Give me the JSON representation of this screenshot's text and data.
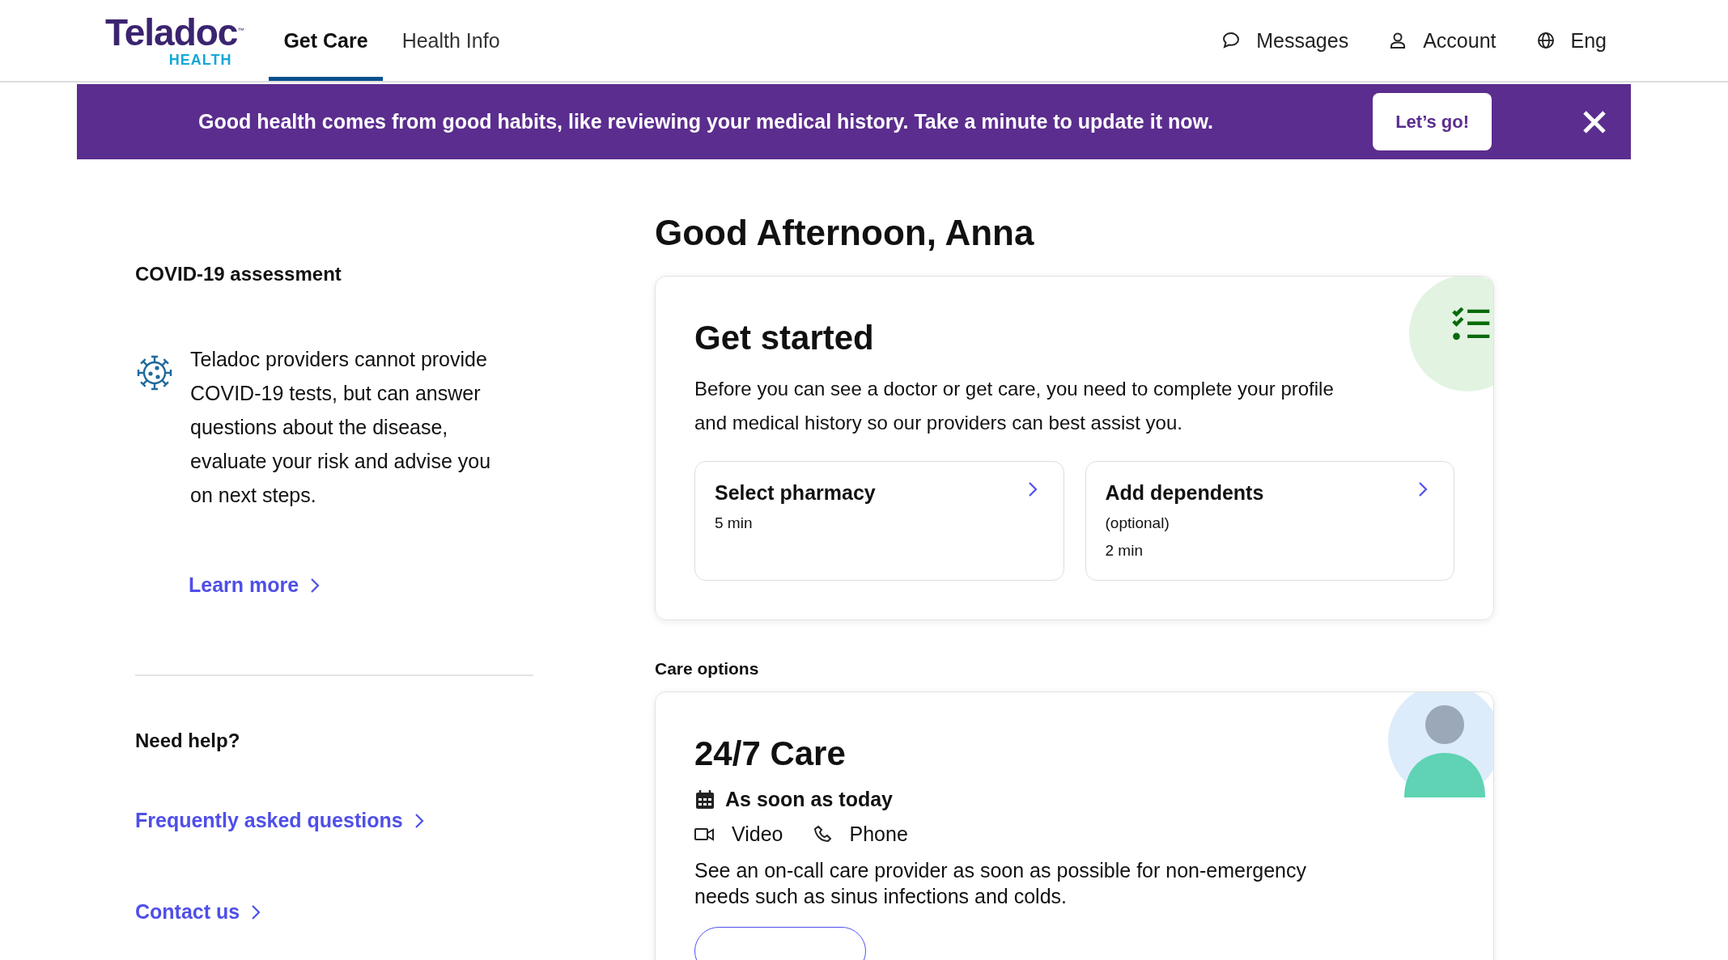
{
  "header": {
    "logo": {
      "wordmark": "Teladoc",
      "tagline": "HEALTH",
      "mark": "™"
    },
    "tabs": [
      {
        "label": "Get Care",
        "selected": true
      },
      {
        "label": "Health Info",
        "selected": false
      }
    ],
    "nav": [
      {
        "kind": "messages",
        "label": "Messages"
      },
      {
        "kind": "account",
        "label": "Account"
      },
      {
        "kind": "language",
        "label": "Eng"
      }
    ]
  },
  "banner": {
    "text": "Good health comes from good habits, like reviewing your medical history. Take a minute to update it now.",
    "button": "Let’s go!"
  },
  "sidebar": {
    "covid": {
      "title": "COVID-19 assessment",
      "text": "Teladoc providers cannot provide COVID-19 tests, but can answer questions about the disease, evaluate your risk and advise you on next steps.",
      "link": "Learn more"
    },
    "help": {
      "title": "Need help?",
      "links": [
        "Frequently asked questions",
        "Contact us"
      ]
    }
  },
  "greeting": "Good Afternoon, Anna",
  "get_started": {
    "title": "Get started",
    "description": "Before you can see a doctor or get care, you need to complete your profile and medical history so our providers can best assist you.",
    "tasks": [
      {
        "title": "Select pharmacy",
        "time": "5 min"
      },
      {
        "title": "Add dependents",
        "note": "(optional)",
        "time": "2 min"
      }
    ]
  },
  "care_options": {
    "heading": "Care options",
    "cards": [
      {
        "title": "24/7 Care",
        "availability": "As soon as today",
        "modes": [
          {
            "kind": "video",
            "label": "Video"
          },
          {
            "kind": "phone",
            "label": "Phone"
          }
        ],
        "description": "See an on-call care provider as soon as possible for non-emergency needs such as sinus infections and colds."
      }
    ]
  }
}
